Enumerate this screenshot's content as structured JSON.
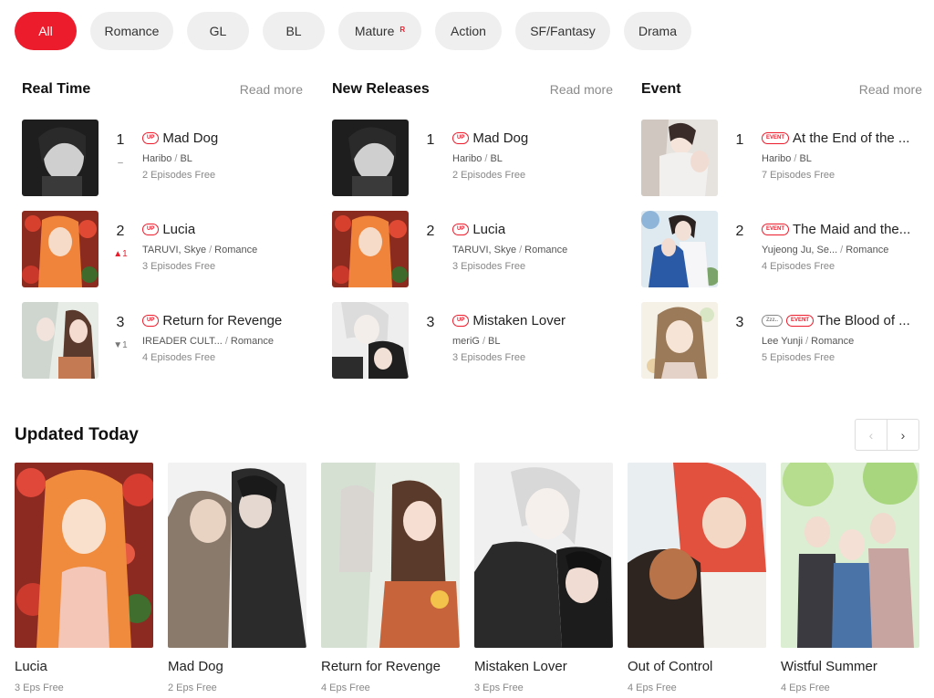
{
  "genres": [
    "All",
    "Romance",
    "GL",
    "BL",
    "Mature",
    "Action",
    "SF/Fantasy",
    "Drama"
  ],
  "mature_badge": "R",
  "read_more": "Read more",
  "columns": [
    {
      "title": "Real Time",
      "items": [
        {
          "rank": "1",
          "change": "–",
          "badge": "UP",
          "title": "Mad Dog",
          "author": "Haribo",
          "genre": "BL",
          "free": "2 Episodes Free"
        },
        {
          "rank": "2",
          "change": "▲1",
          "badge": "UP",
          "title": "Lucia",
          "author": "TARUVI, Skye",
          "genre": "Romance",
          "free": "3 Episodes Free"
        },
        {
          "rank": "3",
          "change": "▼1",
          "badge": "UP",
          "title": "Return for Revenge",
          "author": "IREADER CULT...",
          "genre": "Romance",
          "free": "4 Episodes Free"
        }
      ]
    },
    {
      "title": "New Releases",
      "items": [
        {
          "rank": "1",
          "change": "",
          "badge": "UP",
          "title": "Mad Dog",
          "author": "Haribo",
          "genre": "BL",
          "free": "2 Episodes Free"
        },
        {
          "rank": "2",
          "change": "",
          "badge": "UP",
          "title": "Lucia",
          "author": "TARUVI, Skye",
          "genre": "Romance",
          "free": "3 Episodes Free"
        },
        {
          "rank": "3",
          "change": "",
          "badge": "UP",
          "title": "Mistaken Lover",
          "author": "meriG",
          "genre": "BL",
          "free": "3 Episodes Free"
        }
      ]
    },
    {
      "title": "Event",
      "items": [
        {
          "rank": "1",
          "change": "",
          "badge": "EVENT",
          "title": "At the End of the ...",
          "author": "Haribo",
          "genre": "BL",
          "free": "7 Episodes Free"
        },
        {
          "rank": "2",
          "change": "",
          "badge": "EVENT",
          "title": "The Maid and the...",
          "author": "Yujeong Ju, Se...",
          "genre": "Romance",
          "free": "4 Episodes Free"
        },
        {
          "rank": "3",
          "change": "",
          "badge2": "Zzz..",
          "badge": "EVENT",
          "title": "The Blood of ...",
          "author": "Lee Yunji",
          "genre": "Romance",
          "free": "5 Episodes Free"
        }
      ]
    }
  ],
  "updated_today": {
    "title": "Updated Today",
    "prev_icon": "‹",
    "next_icon": "›",
    "cards": [
      {
        "title": "Lucia",
        "free": "3 Eps Free"
      },
      {
        "title": "Mad Dog",
        "free": "2 Eps Free"
      },
      {
        "title": "Return for Revenge",
        "free": "4 Eps Free"
      },
      {
        "title": "Mistaken Lover",
        "free": "3 Eps Free"
      },
      {
        "title": "Out of Control",
        "free": "4 Eps Free"
      },
      {
        "title": "Wistful Summer",
        "free": "4 Eps Free"
      }
    ]
  },
  "colors": {
    "accent": "#ec1c2c",
    "chip_bg": "#efefef",
    "muted": "#888888"
  }
}
